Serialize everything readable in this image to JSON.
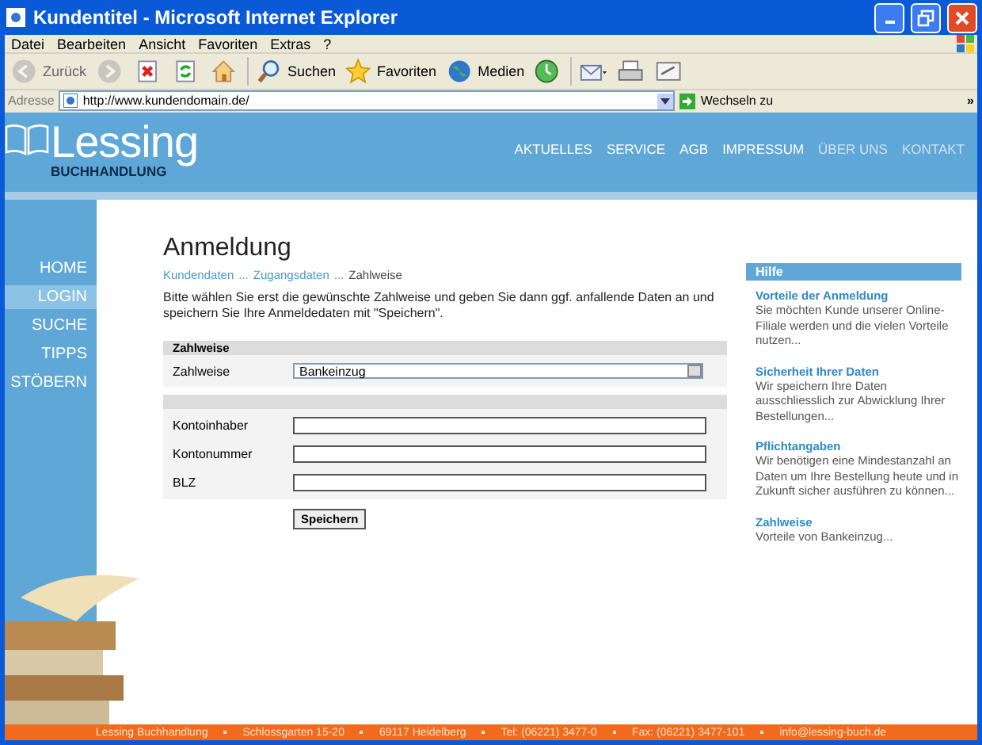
{
  "window": {
    "title": "Kundentitel - Microsoft Internet Explorer"
  },
  "menu": [
    "Datei",
    "Bearbeiten",
    "Ansicht",
    "Favoriten",
    "Extras",
    "?"
  ],
  "toolbar": [
    {
      "kind": "back",
      "label": "Zurück",
      "disabled": true
    },
    {
      "kind": "forward",
      "disabled": true
    },
    {
      "kind": "stop",
      "disabled": false
    },
    {
      "kind": "refresh",
      "disabled": false
    },
    {
      "kind": "home",
      "disabled": false
    },
    {
      "kind": "search",
      "label": "Suchen",
      "disabled": false
    },
    {
      "kind": "favorites",
      "label": "Favoriten",
      "disabled": false
    },
    {
      "kind": "media",
      "label": "Medien",
      "disabled": false
    },
    {
      "kind": "history",
      "disabled": false
    },
    {
      "kind": "mail",
      "disabled": false
    },
    {
      "kind": "print",
      "disabled": false
    },
    {
      "kind": "edit",
      "disabled": false
    }
  ],
  "address": {
    "label": "Adresse",
    "url": "http://www.kundendomain.de/",
    "go_label": "Wechseln zu",
    "more": "»"
  },
  "site": {
    "logo": {
      "name": "Lessing",
      "subtitle": "BUCHHANDLUNG"
    },
    "top_nav": [
      {
        "label": "AKTUELLES",
        "dimmed": false
      },
      {
        "label": "SERVICE",
        "dimmed": false
      },
      {
        "label": "AGB",
        "dimmed": false
      },
      {
        "label": "IMPRESSUM",
        "dimmed": false
      },
      {
        "label": "ÜBER UNS",
        "dimmed": true
      },
      {
        "label": "KONTAKT",
        "dimmed": true
      }
    ],
    "side_nav": [
      {
        "label": "HOME",
        "selected": false
      },
      {
        "label": "LOGIN",
        "selected": true
      },
      {
        "label": "SUCHE",
        "selected": false
      },
      {
        "label": "TIPPS",
        "selected": false
      },
      {
        "label": "STÖBERN",
        "selected": false
      }
    ],
    "page": {
      "title": "Anmeldung",
      "breadcrumb": [
        {
          "label": "Kundendaten",
          "kind": "link"
        },
        {
          "label": "...",
          "kind": "sep"
        },
        {
          "label": "Zugangsdaten",
          "kind": "link"
        },
        {
          "label": "...",
          "kind": "sep"
        },
        {
          "label": "Zahlweise",
          "kind": "current"
        }
      ],
      "intro": "Bitte wählen Sie erst die gewünschte Zahlweise und geben Sie dann ggf. anfallende Daten an und speichern Sie Ihre Anmeldedaten mit \"Speichern\".",
      "sections": [
        {
          "title": "Zahlweise",
          "fields": [
            {
              "label": "Zahlweise",
              "kind": "select",
              "value": "Bankeinzug"
            }
          ]
        },
        {
          "fields": [
            {
              "label": "Kontoinhaber",
              "kind": "text"
            },
            {
              "label": "Kontonummer",
              "kind": "text"
            },
            {
              "label": "BLZ",
              "kind": "text"
            }
          ]
        }
      ],
      "save_button": "Speichern"
    },
    "help": {
      "title": "Hilfe",
      "items": [
        {
          "title": "Vorteile der Anmeldung",
          "text": "Sie möchten Kunde unserer Online-Filiale werden und die vielen Vorteile nutzen..."
        },
        {
          "title": "Sicherheit Ihrer Daten",
          "text": "Wir speichern Ihre Daten ausschliesslich zur Abwicklung Ihrer Bestellungen..."
        },
        {
          "title": "Pflichtangaben",
          "text": "Wir benötigen eine Mindestanzahl an Daten um Ihre Bestellung heute und in Zukunft sicher ausführen zu können..."
        },
        {
          "title": "Zahlweise",
          "text": "Vorteile von Bankeinzug..."
        }
      ]
    },
    "footer": [
      "Lessing Buchhandlung",
      "Schlossgarten 15-20",
      "69117 Heidelberg",
      "Tel: (06221) 3477-0",
      "Fax: (06221) 3477-101",
      "info@lessing-buch.de"
    ]
  }
}
